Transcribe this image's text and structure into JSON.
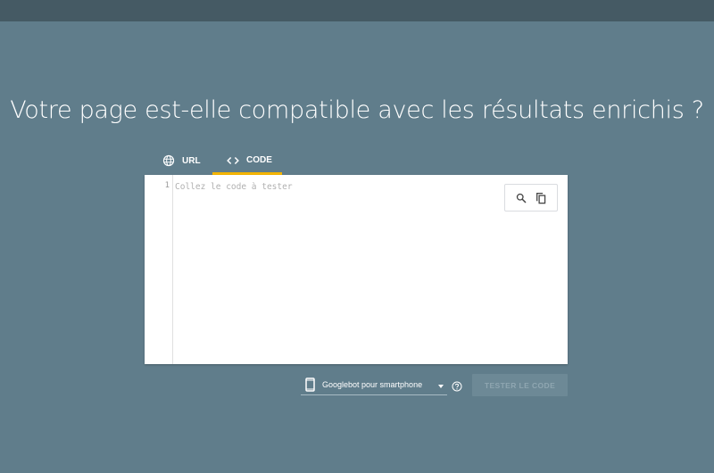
{
  "page": {
    "title": "Votre page est-elle compatible avec les résultats enrichis ?"
  },
  "tabs": [
    {
      "label": "URL",
      "icon": "globe-icon",
      "active": false
    },
    {
      "label": "CODE",
      "icon": "code-brackets-icon",
      "active": true
    }
  ],
  "editor": {
    "line_number": "1",
    "placeholder": "Collez le code à tester",
    "value": "",
    "tools": [
      "search-icon",
      "copy-icon"
    ]
  },
  "controls": {
    "device_select_value": "Googlebot pour smartphone",
    "device_icon": "smartphone-icon",
    "help_icon": "help-circle-icon",
    "test_button_label": "TESTER LE CODE",
    "test_button_enabled": false
  },
  "colors": {
    "background": "#607d8b",
    "topbar": "#455a64",
    "active_tab_underline": "#f4b400",
    "editor_background": "#ffffff"
  }
}
